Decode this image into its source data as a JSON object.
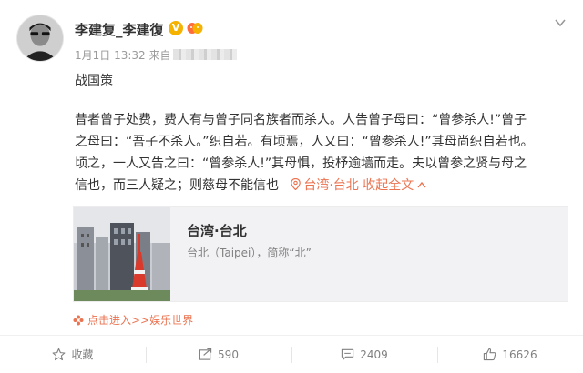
{
  "post": {
    "username": "李建复_李建復",
    "verified_icon": "verified-badge-icon",
    "member_icon": "vip-member-icon",
    "meta_date": "1月1日 13:32",
    "meta_from": "来自",
    "title": "战国策",
    "body_lines": [
      "昔者曾子处费，费人有与曾子同名族者而杀人。人告曾子母曰：“曾参杀人!”曾子",
      "之母曰：“吾子不杀人。”织自若。有顷焉，人又曰：“曾参杀人!”其母尚织自若也。",
      "顷之，一人又告之曰：“曾参杀人!”其母惧，投杼逾墙而走。夫以曾参之贤与母之",
      "信也，而三人疑之；则慈母不能信也"
    ],
    "inline_location": "台湾·台北",
    "collapse_label": "收起全文"
  },
  "location_card": {
    "name": "台湾·台北",
    "description": "台北（Taipei），简称“北”"
  },
  "source_link": "点击进入>>娱乐世界",
  "actions": {
    "favorite": "收藏",
    "repost": "590",
    "comment": "2409",
    "like": "16626"
  },
  "colors": {
    "accent": "#eb7350",
    "muted": "#808080",
    "verified": "#f5b200"
  }
}
